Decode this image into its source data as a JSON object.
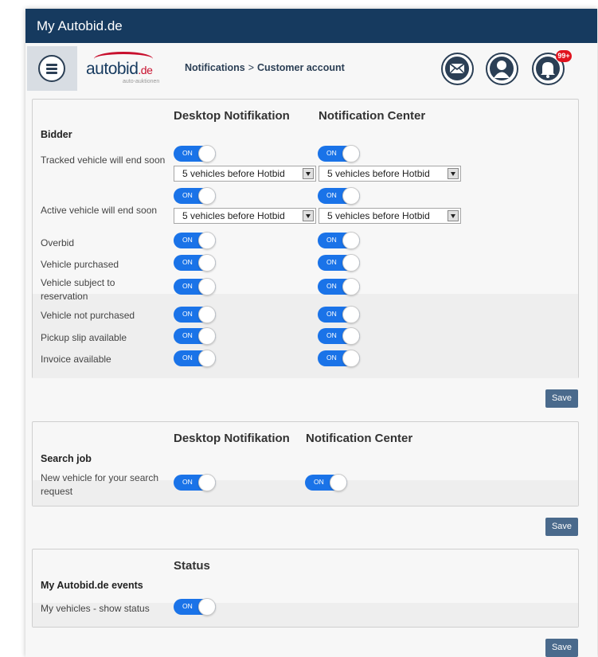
{
  "app": {
    "title": "My Autobid.de"
  },
  "header": {
    "logo_text": "autobid",
    "logo_tld": ".de",
    "logo_subtitle": "auto-auktionen",
    "breadcrumb": [
      "Notifications",
      "Customer account"
    ],
    "breadcrumb_separator": ">",
    "notification_badge": "99+"
  },
  "bidder_panel": {
    "column_desktop": "Desktop Notifikation",
    "column_center": "Notification Center",
    "section_title": "Bidder",
    "rows": [
      {
        "label": "Tracked vehicle will end soon",
        "desktop": "ON",
        "center": "ON",
        "desktop_select": "5 vehicles before Hotbid",
        "center_select": "5 vehicles before Hotbid"
      },
      {
        "label": "Active vehicle will end soon",
        "desktop": "ON",
        "center": "ON",
        "desktop_select": "5 vehicles before Hotbid",
        "center_select": "5 vehicles before Hotbid"
      },
      {
        "label": "Overbid",
        "desktop": "ON",
        "center": "ON"
      },
      {
        "label": "Vehicle purchased",
        "desktop": "ON",
        "center": "ON"
      },
      {
        "label": "Vehicle subject to reservation",
        "desktop": "ON",
        "center": "ON"
      },
      {
        "label": "Vehicle not purchased",
        "desktop": "ON",
        "center": "ON"
      },
      {
        "label": "Pickup slip available",
        "desktop": "ON",
        "center": "ON"
      },
      {
        "label": "Invoice available",
        "desktop": "ON",
        "center": "ON"
      }
    ],
    "save_label": "Save"
  },
  "search_panel": {
    "column_desktop": "Desktop Notifikation",
    "column_center": "Notification Center",
    "section_title": "Search job",
    "rows": [
      {
        "label": "New vehicle for your search request",
        "desktop": "ON",
        "center": "ON"
      }
    ],
    "save_label": "Save"
  },
  "status_panel": {
    "column_status": "Status",
    "section_title": "My Autobid.de events",
    "rows": [
      {
        "label": "My vehicles - show status",
        "status": "ON"
      }
    ],
    "save_label": "Save"
  },
  "colors": {
    "titlebar": "#163a5f",
    "toggle_on": "#1a73e8",
    "save_button": "#4a6a8c",
    "badge": "#e0131e",
    "brand_red": "#c8102e"
  },
  "icons": [
    "hamburger-menu-icon",
    "mail-icon",
    "user-icon",
    "bell-icon",
    "dropdown-arrow-icon"
  ]
}
